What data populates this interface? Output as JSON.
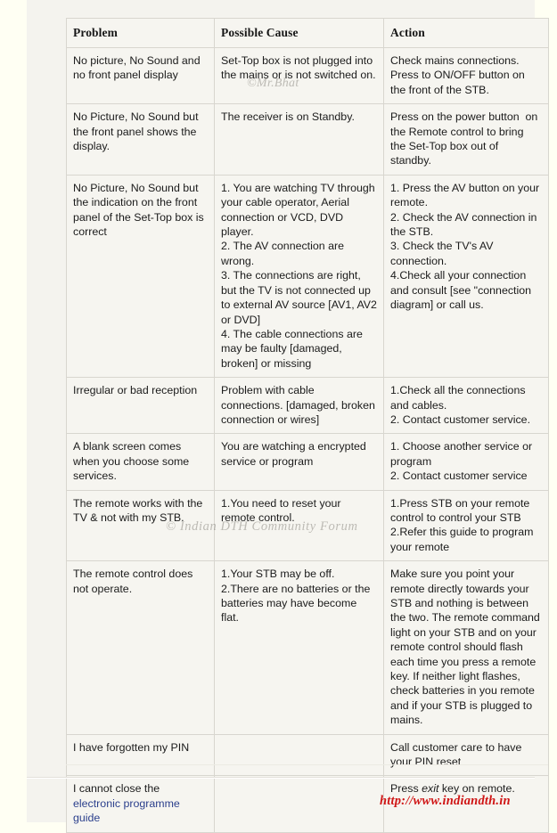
{
  "document": {
    "type": "troubleshooting-table",
    "footer_url": "http://www.indiandth.in",
    "watermarks": {
      "top": "©Mr.Bhat",
      "middle": "© Indian DTH Community Forum"
    }
  },
  "table": {
    "headers": [
      "Problem",
      "Possible Cause",
      "Action"
    ],
    "rows": [
      {
        "problem": "No picture, No Sound and no front panel display",
        "cause": "Set-Top box is not plugged into the mains or is not switched on.",
        "action": "Check mains connections.\nPress to ON/OFF button on the front of the STB."
      },
      {
        "problem": "No Picture, No Sound but the front panel shows the display.",
        "cause": "The receiver is on Standby.",
        "action": "Press on the power button  on the Remote control to bring the Set-Top box out of standby."
      },
      {
        "problem": "No Picture, No Sound but the indication on the front panel of the Set-Top box is correct",
        "cause": "1. You are watching TV through your cable operator, Aerial connection or VCD, DVD player.\n2. The AV connection are wrong.\n3. The connections are right, but the TV is not connected up to external AV source [AV1, AV2 or DVD]\n4. The cable connections are may be faulty [damaged, broken] or missing",
        "action": "1. Press the AV button on your remote.\n2. Check the AV connection in the STB.\n3. Check the TV's AV connection.\n4.Check all your connection and consult [see \"connection diagram] or call us."
      },
      {
        "problem": "Irregular or bad reception",
        "cause": "Problem with cable connections. [damaged, broken connection or wires]",
        "action": "1.Check all the connections and cables.\n2. Contact customer service."
      },
      {
        "problem": "A blank screen comes when you choose some services.",
        "cause": "You are watching a encrypted service or program",
        "action": "1. Choose another service or program\n2. Contact customer service"
      },
      {
        "problem": "The remote works with the TV & not with my STB.",
        "cause": "1.You need to reset your remote control.",
        "action": "1.Press STB on your remote control to control your STB\n2.Refer this guide to program your remote"
      },
      {
        "problem": "The remote control does not operate.",
        "cause": "1.Your STB may be off.\n2.There are no batteries or the batteries may have become flat.",
        "action": "Make sure you point your remote directly towards your STB and nothing is between the two. The remote command light on your STB and on your remote control should flash each time you press a remote key. If neither light flashes, check batteries in you remote and if your STB is plugged to mains."
      },
      {
        "problem": "I have forgotten my PIN",
        "cause": "",
        "action": "Call customer care to have your PIN reset"
      },
      {
        "problem_plain": "I cannot close the",
        "problem_link": "electronic programme guide",
        "cause": "",
        "action_pre": "Press ",
        "action_italic": "exit",
        "action_post": " key on remote."
      }
    ]
  }
}
